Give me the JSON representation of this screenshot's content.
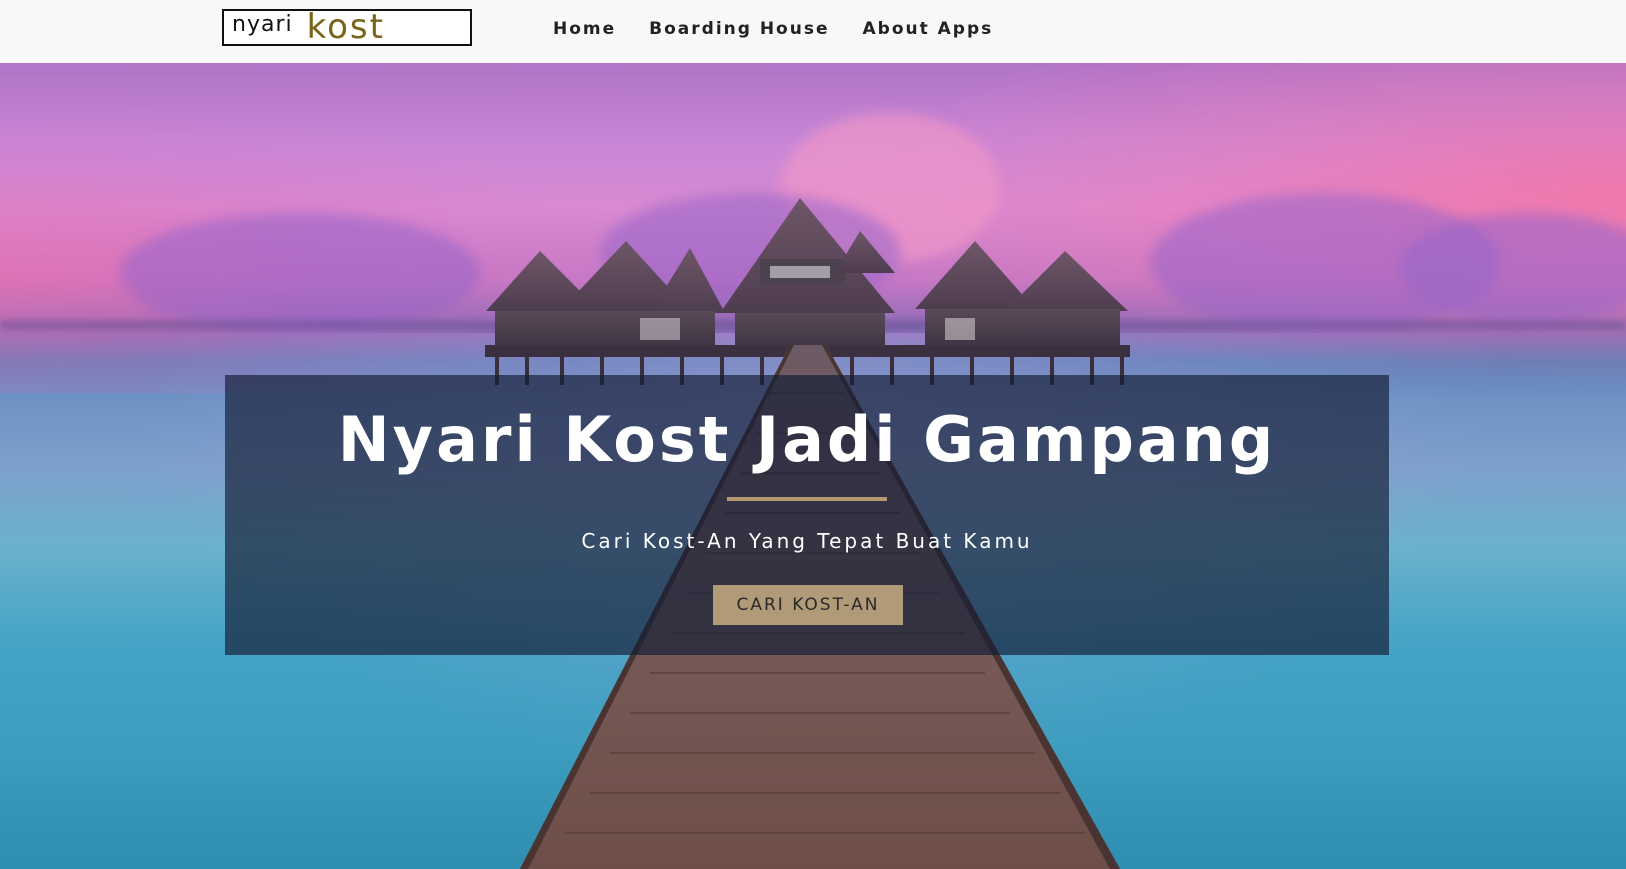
{
  "navbar": {
    "logo": {
      "word1": "nyari",
      "word2": "kost"
    },
    "links": [
      {
        "label": "Home"
      },
      {
        "label": "Boarding House"
      },
      {
        "label": "About Apps"
      }
    ]
  },
  "hero": {
    "title": "Nyari Kost Jadi Gampang",
    "subtitle": "Cari Kost-An Yang Tepat Buat Kamu",
    "cta_label": "CARI KOST-AN"
  },
  "colors": {
    "accent": "#b59a70",
    "logo_accent": "#7a6418",
    "navbar_bg": "#f8f8f8",
    "panel_bg": "rgba(20,30,55,0.68)"
  }
}
